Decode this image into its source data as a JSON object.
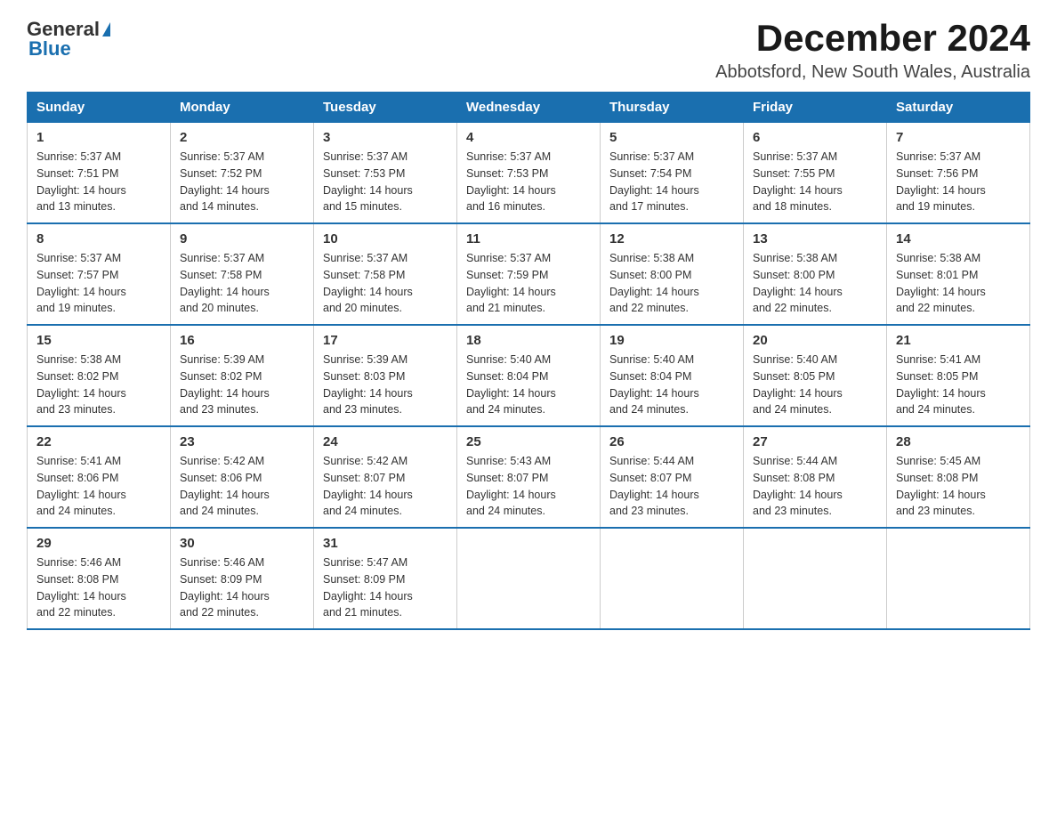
{
  "logo": {
    "text_general": "General",
    "text_blue": "Blue"
  },
  "title": "December 2024",
  "subtitle": "Abbotsford, New South Wales, Australia",
  "calendar": {
    "headers": [
      "Sunday",
      "Monday",
      "Tuesday",
      "Wednesday",
      "Thursday",
      "Friday",
      "Saturday"
    ],
    "weeks": [
      [
        {
          "day": "1",
          "sunrise": "5:37 AM",
          "sunset": "7:51 PM",
          "daylight": "14 hours and 13 minutes."
        },
        {
          "day": "2",
          "sunrise": "5:37 AM",
          "sunset": "7:52 PM",
          "daylight": "14 hours and 14 minutes."
        },
        {
          "day": "3",
          "sunrise": "5:37 AM",
          "sunset": "7:53 PM",
          "daylight": "14 hours and 15 minutes."
        },
        {
          "day": "4",
          "sunrise": "5:37 AM",
          "sunset": "7:53 PM",
          "daylight": "14 hours and 16 minutes."
        },
        {
          "day": "5",
          "sunrise": "5:37 AM",
          "sunset": "7:54 PM",
          "daylight": "14 hours and 17 minutes."
        },
        {
          "day": "6",
          "sunrise": "5:37 AM",
          "sunset": "7:55 PM",
          "daylight": "14 hours and 18 minutes."
        },
        {
          "day": "7",
          "sunrise": "5:37 AM",
          "sunset": "7:56 PM",
          "daylight": "14 hours and 19 minutes."
        }
      ],
      [
        {
          "day": "8",
          "sunrise": "5:37 AM",
          "sunset": "7:57 PM",
          "daylight": "14 hours and 19 minutes."
        },
        {
          "day": "9",
          "sunrise": "5:37 AM",
          "sunset": "7:58 PM",
          "daylight": "14 hours and 20 minutes."
        },
        {
          "day": "10",
          "sunrise": "5:37 AM",
          "sunset": "7:58 PM",
          "daylight": "14 hours and 20 minutes."
        },
        {
          "day": "11",
          "sunrise": "5:37 AM",
          "sunset": "7:59 PM",
          "daylight": "14 hours and 21 minutes."
        },
        {
          "day": "12",
          "sunrise": "5:38 AM",
          "sunset": "8:00 PM",
          "daylight": "14 hours and 22 minutes."
        },
        {
          "day": "13",
          "sunrise": "5:38 AM",
          "sunset": "8:00 PM",
          "daylight": "14 hours and 22 minutes."
        },
        {
          "day": "14",
          "sunrise": "5:38 AM",
          "sunset": "8:01 PM",
          "daylight": "14 hours and 22 minutes."
        }
      ],
      [
        {
          "day": "15",
          "sunrise": "5:38 AM",
          "sunset": "8:02 PM",
          "daylight": "14 hours and 23 minutes."
        },
        {
          "day": "16",
          "sunrise": "5:39 AM",
          "sunset": "8:02 PM",
          "daylight": "14 hours and 23 minutes."
        },
        {
          "day": "17",
          "sunrise": "5:39 AM",
          "sunset": "8:03 PM",
          "daylight": "14 hours and 23 minutes."
        },
        {
          "day": "18",
          "sunrise": "5:40 AM",
          "sunset": "8:04 PM",
          "daylight": "14 hours and 24 minutes."
        },
        {
          "day": "19",
          "sunrise": "5:40 AM",
          "sunset": "8:04 PM",
          "daylight": "14 hours and 24 minutes."
        },
        {
          "day": "20",
          "sunrise": "5:40 AM",
          "sunset": "8:05 PM",
          "daylight": "14 hours and 24 minutes."
        },
        {
          "day": "21",
          "sunrise": "5:41 AM",
          "sunset": "8:05 PM",
          "daylight": "14 hours and 24 minutes."
        }
      ],
      [
        {
          "day": "22",
          "sunrise": "5:41 AM",
          "sunset": "8:06 PM",
          "daylight": "14 hours and 24 minutes."
        },
        {
          "day": "23",
          "sunrise": "5:42 AM",
          "sunset": "8:06 PM",
          "daylight": "14 hours and 24 minutes."
        },
        {
          "day": "24",
          "sunrise": "5:42 AM",
          "sunset": "8:07 PM",
          "daylight": "14 hours and 24 minutes."
        },
        {
          "day": "25",
          "sunrise": "5:43 AM",
          "sunset": "8:07 PM",
          "daylight": "14 hours and 24 minutes."
        },
        {
          "day": "26",
          "sunrise": "5:44 AM",
          "sunset": "8:07 PM",
          "daylight": "14 hours and 23 minutes."
        },
        {
          "day": "27",
          "sunrise": "5:44 AM",
          "sunset": "8:08 PM",
          "daylight": "14 hours and 23 minutes."
        },
        {
          "day": "28",
          "sunrise": "5:45 AM",
          "sunset": "8:08 PM",
          "daylight": "14 hours and 23 minutes."
        }
      ],
      [
        {
          "day": "29",
          "sunrise": "5:46 AM",
          "sunset": "8:08 PM",
          "daylight": "14 hours and 22 minutes."
        },
        {
          "day": "30",
          "sunrise": "5:46 AM",
          "sunset": "8:09 PM",
          "daylight": "14 hours and 22 minutes."
        },
        {
          "day": "31",
          "sunrise": "5:47 AM",
          "sunset": "8:09 PM",
          "daylight": "14 hours and 21 minutes."
        },
        null,
        null,
        null,
        null
      ]
    ]
  },
  "labels": {
    "sunrise": "Sunrise:",
    "sunset": "Sunset:",
    "daylight": "Daylight:"
  }
}
